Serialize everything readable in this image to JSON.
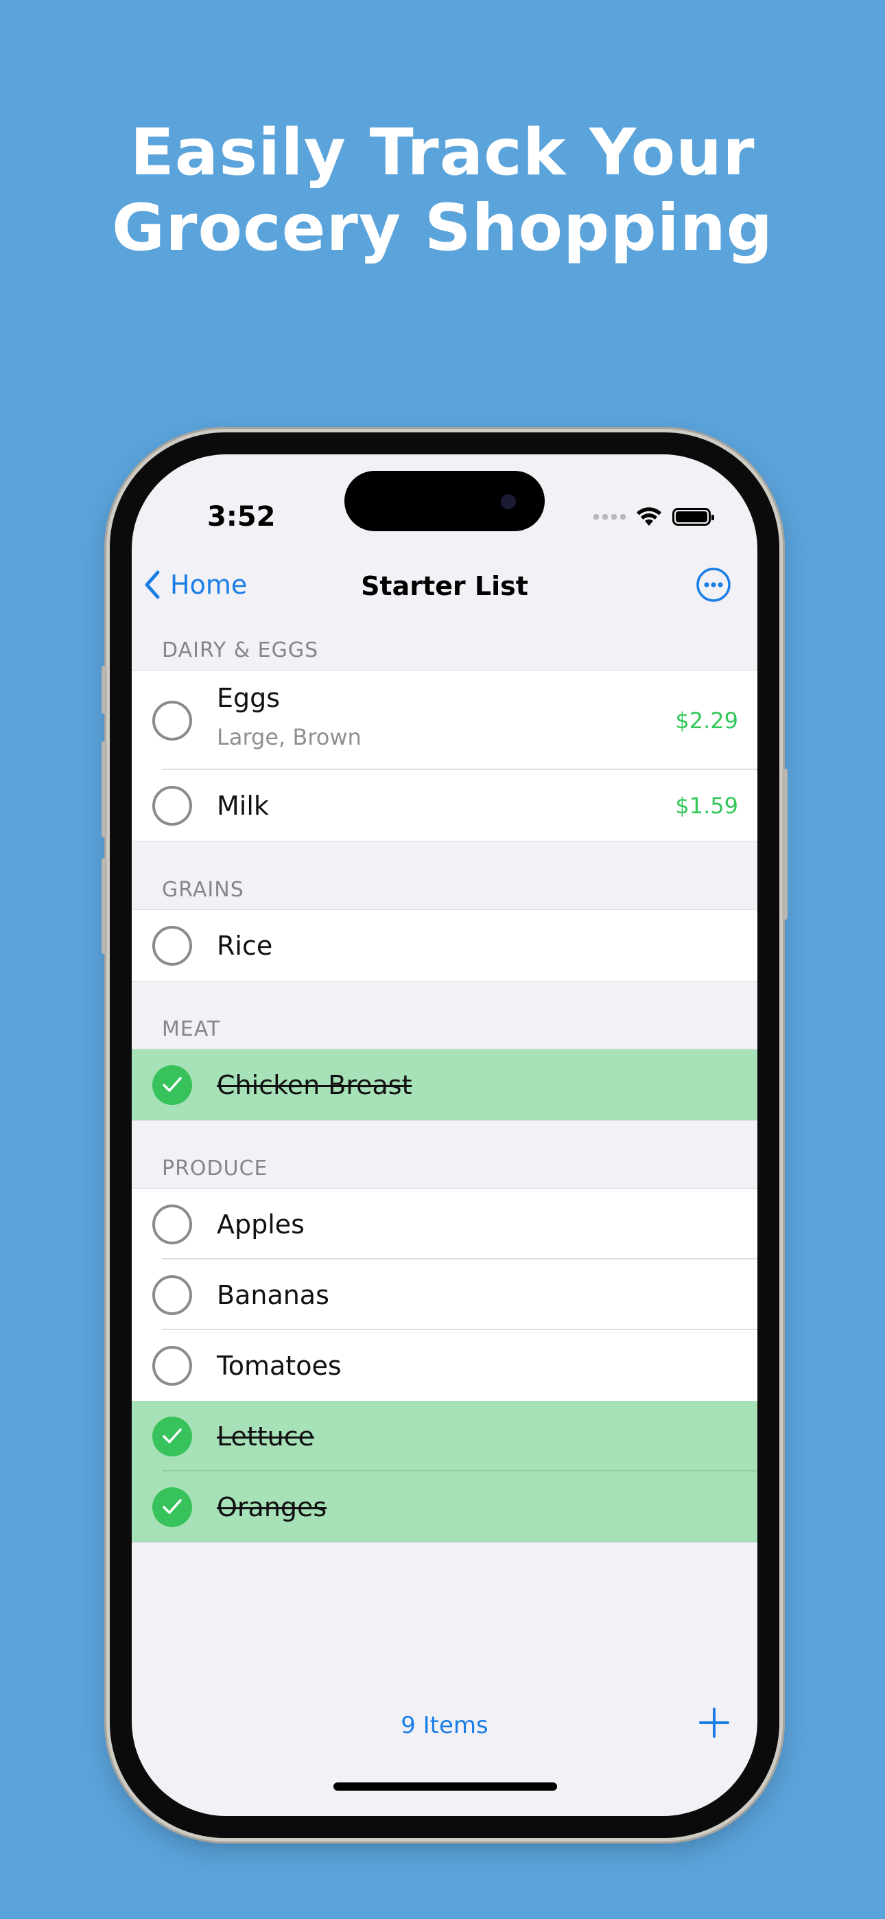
{
  "headline": {
    "line1": "Easily Track Your",
    "line2": "Grocery Shopping"
  },
  "status_bar": {
    "time": "3:52"
  },
  "nav": {
    "back_label": "Home",
    "title": "Starter List",
    "more_icon": "ellipsis-circle-icon"
  },
  "sections": [
    {
      "header": "DAIRY & EGGS",
      "items": [
        {
          "name": "Eggs",
          "detail": "Large, Brown",
          "price": "$2.29",
          "checked": false
        },
        {
          "name": "Milk",
          "price": "$1.59",
          "checked": false
        }
      ]
    },
    {
      "header": "GRAINS",
      "items": [
        {
          "name": "Rice",
          "checked": false
        }
      ]
    },
    {
      "header": "MEAT",
      "items": [
        {
          "name": "Chicken Breast",
          "checked": true
        }
      ]
    },
    {
      "header": "PRODUCE",
      "items": [
        {
          "name": "Apples",
          "checked": false
        },
        {
          "name": "Bananas",
          "checked": false
        },
        {
          "name": "Tomatoes",
          "checked": false
        },
        {
          "name": "Lettuce",
          "checked": true
        },
        {
          "name": "Oranges",
          "checked": true
        }
      ]
    }
  ],
  "footer": {
    "count_label": "9 Items",
    "add_icon": "plus-icon"
  },
  "colors": {
    "background": "#5aa3db",
    "accent": "#1a7ee6",
    "price": "#34c759",
    "checked_row": "#a7e1b8",
    "checkmark": "#37c25b"
  }
}
